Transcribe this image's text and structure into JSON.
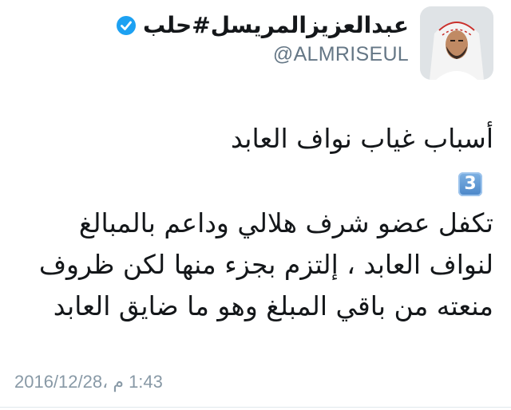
{
  "tweet": {
    "author": {
      "display_name": "عبدالعزيزالمريسل#حلب",
      "handle": "@ALMRISEUL",
      "verified_icon": "verified-badge-icon",
      "verified_color": "#1da1f2"
    },
    "menu_icon": "chevron-down-icon",
    "lines": [
      "أسباب غياب نواف العابد",
      "تكفل عضو شرف هلالي وداعم بالمبالغ",
      "لنواف العابد ، إلتزم بجزء منها لكن ظروف",
      "منعته من باقي المبلغ وهو ما ضايق العابد"
    ],
    "keycap_number": "3",
    "keycap_color": "#4a86c8",
    "timestamp": "1:43 م ،2016/12/28"
  }
}
